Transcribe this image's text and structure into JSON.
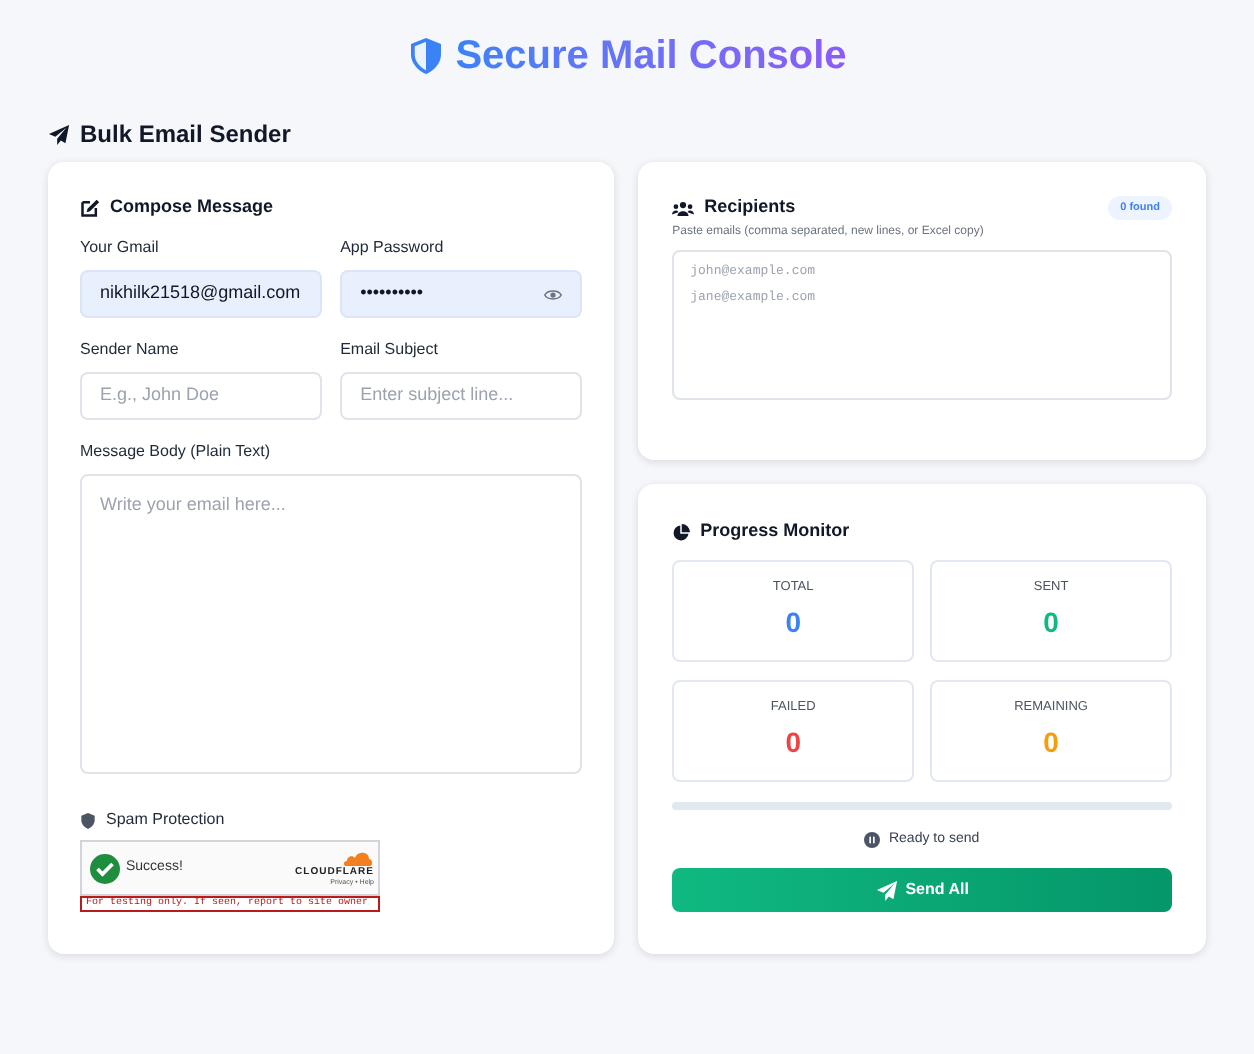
{
  "header": {
    "title": "Secure Mail Console"
  },
  "section_title": "Bulk Email Sender",
  "compose": {
    "title": "Compose Message",
    "fields": [
      {
        "label": "Your Gmail",
        "value": "nikhilk21518@gmail.com",
        "filled": true,
        "kind": "text"
      },
      {
        "label": "App Password",
        "value": "••••••••••",
        "filled": true,
        "kind": "password"
      },
      {
        "label": "Sender Name",
        "placeholder": "E.g., John Doe",
        "filled": false,
        "kind": "text"
      },
      {
        "label": "Email Subject",
        "placeholder": "Enter subject line...",
        "filled": false,
        "kind": "text"
      }
    ],
    "body": {
      "label": "Message Body (Plain Text)",
      "placeholder": "Write your email here..."
    },
    "spam": {
      "label": "Spam Protection",
      "status": "Success!",
      "brand": "CLOUDFLARE",
      "links": "Privacy • Help",
      "warning": "For testing only. If seen, report to site owner"
    }
  },
  "recipients": {
    "title": "Recipients",
    "badge": "0 found",
    "hint": "Paste emails (comma separated, new lines, or Excel copy)",
    "placeholder_lines": [
      "john@example.com",
      "jane@example.com"
    ]
  },
  "progress": {
    "title": "Progress Monitor",
    "stats": [
      {
        "label": "TOTAL",
        "value": "0",
        "color": "#3b82f6"
      },
      {
        "label": "SENT",
        "value": "0",
        "color": "#10b981"
      },
      {
        "label": "FAILED",
        "value": "0",
        "color": "#ef4444"
      },
      {
        "label": "REMAINING",
        "value": "0",
        "color": "#f59e0b"
      }
    ],
    "level": 0,
    "status": "Ready to send",
    "button": "Send All"
  }
}
